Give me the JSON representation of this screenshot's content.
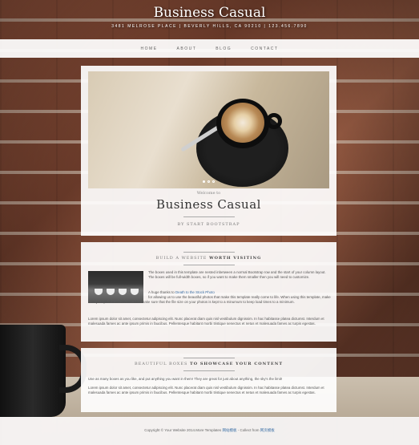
{
  "header": {
    "brand": "Business Casual",
    "address": "3481 MELROSE PLACE | BEVERLY HILLS, CA 90210 | 123.456.7890"
  },
  "nav": {
    "items": [
      "HOME",
      "ABOUT",
      "BLOG",
      "CONTACT"
    ]
  },
  "hero": {
    "welcome": "Welcome to",
    "title": "Business Casual",
    "byline": "BY START BOOTSTRAP"
  },
  "about_section": {
    "heading_prefix": "BUILD A WEBSITE",
    "heading_strong": "WORTH VISITING",
    "para1": "The boxes used in this template are nested inbetween a normal Bootstrap row and the start of your column layout. The boxes will be full-width boxes, so if you want to make them smaller then you will need to customize.",
    "para2_before": "A huge thanks to",
    "para2_link": "Death to the Stock Photo",
    "para2_after": "for allowing us to use the beautiful photos that make this template really come to life. When using this template, make sure your photos are decent. Also make sure that the file size on your photos is kept to a minumum to keep load times to a minimum.",
    "para3": "Lorem ipsum dolor sit amet, consectetur adipiscing elit. Nunc placerat diam quis nisl vestibulum dignissim. In hac habitasse platea dictumst. Interdum et malesuada fames ac ante ipsum primis in faucibus. Pellentesque habitant morbi tristique senectus et netus et malesuada fames ac turpis egestas."
  },
  "showcase_section": {
    "heading_prefix": "BEAUTIFUL BOXES",
    "heading_strong": "TO SHOWCASE YOUR CONTENT",
    "para1": "Use as many boxes as you like, and put anything you want in them! They are great for just about anything, the sky's the limit!",
    "para2": "Lorem ipsum dolor sit amet, consectetur adipiscing elit. Nunc placerat diam quis nisl vestibulum dignissim. In hac habitasse platea dictumst. Interdum et malesuada fames ac ante ipsum primis in faucibus. Pellentesque habitant morbi tristique senectus et netus et malesuada fames ac turpis egestas."
  },
  "footer": {
    "copyright_prefix": "Copyright © Your Website 2014.More Templates",
    "link1": "网站模板",
    "copyright_mid": "- Collect from",
    "link2": "网页模板"
  },
  "colors": {
    "link": "#3a6ea5",
    "box_bg": "rgba(255,255,255,0.92)"
  }
}
